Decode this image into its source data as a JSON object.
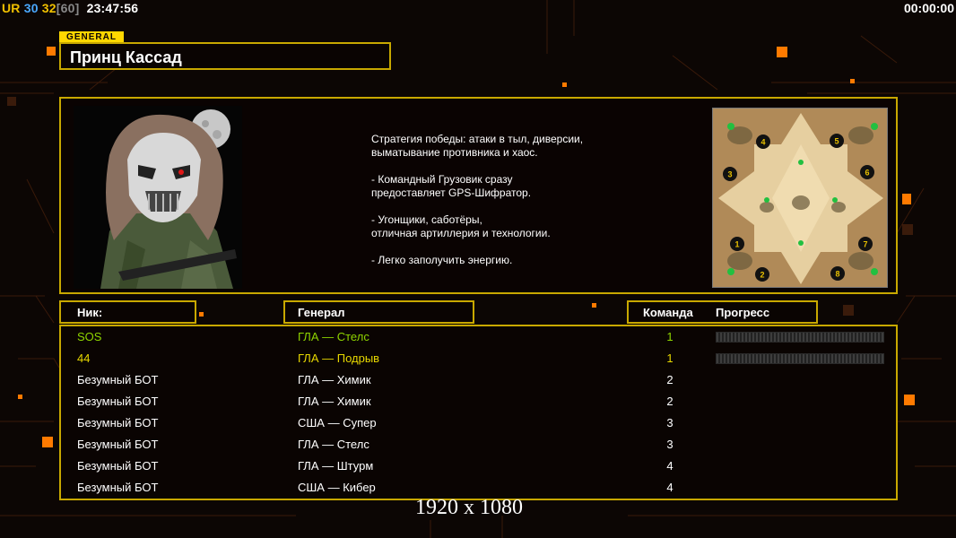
{
  "hud": {
    "left_prefix": "UR",
    "left_num1": "30",
    "left_num2": "32",
    "left_num3": "[60]",
    "left_time": "23:47:56",
    "right_time": "00:00:00"
  },
  "general": {
    "tag": "GENERAL",
    "name": "Принц Кассад",
    "strategy_text": "Стратегия победы: атаки в тыл, диверсии,\n выматывание противника и хаос.\n\n- Командный Грузовик сразу\nпредоставляет GPS-Шифратор.\n\n- Угонщики, саботёры,\nотличная артиллерия и технологии.\n\n- Легко заполучить энергию."
  },
  "minimap": {
    "spawn_labels": [
      "1",
      "2",
      "3",
      "4",
      "5",
      "6",
      "7",
      "8"
    ]
  },
  "table": {
    "headers": {
      "nick": "Ник:",
      "general": "Генерал",
      "team": "Команда",
      "progress": "Прогресс"
    },
    "rows": [
      {
        "nick": "SOS",
        "general": "ГЛА — Стелс",
        "team": "1",
        "color": "#8fd400",
        "progress": 0
      },
      {
        "nick": "44",
        "general": "ГЛА — Подрыв",
        "team": "1",
        "color": "#e8d800",
        "progress": 0
      },
      {
        "nick": "Безумный БОТ",
        "general": "ГЛА — Химик",
        "team": "2",
        "color": "#ffffff"
      },
      {
        "nick": "Безумный БОТ",
        "general": "ГЛА — Химик",
        "team": "2",
        "color": "#ffffff"
      },
      {
        "nick": "Безумный БОТ",
        "general": "США — Супер",
        "team": "3",
        "color": "#ffffff"
      },
      {
        "nick": "Безумный БОТ",
        "general": "ГЛА — Стелс",
        "team": "3",
        "color": "#ffffff"
      },
      {
        "nick": "Безумный БОТ",
        "general": "ГЛА — Штурм",
        "team": "4",
        "color": "#ffffff"
      },
      {
        "nick": "Безумный БОТ",
        "general": "США — Кибер",
        "team": "4",
        "color": "#ffffff"
      }
    ]
  },
  "resolution_label": "1920 x 1080",
  "colors": {
    "frame": "#c8a800",
    "accent_orange": "#ff7a00",
    "tag_yellow": "#ffd700"
  }
}
